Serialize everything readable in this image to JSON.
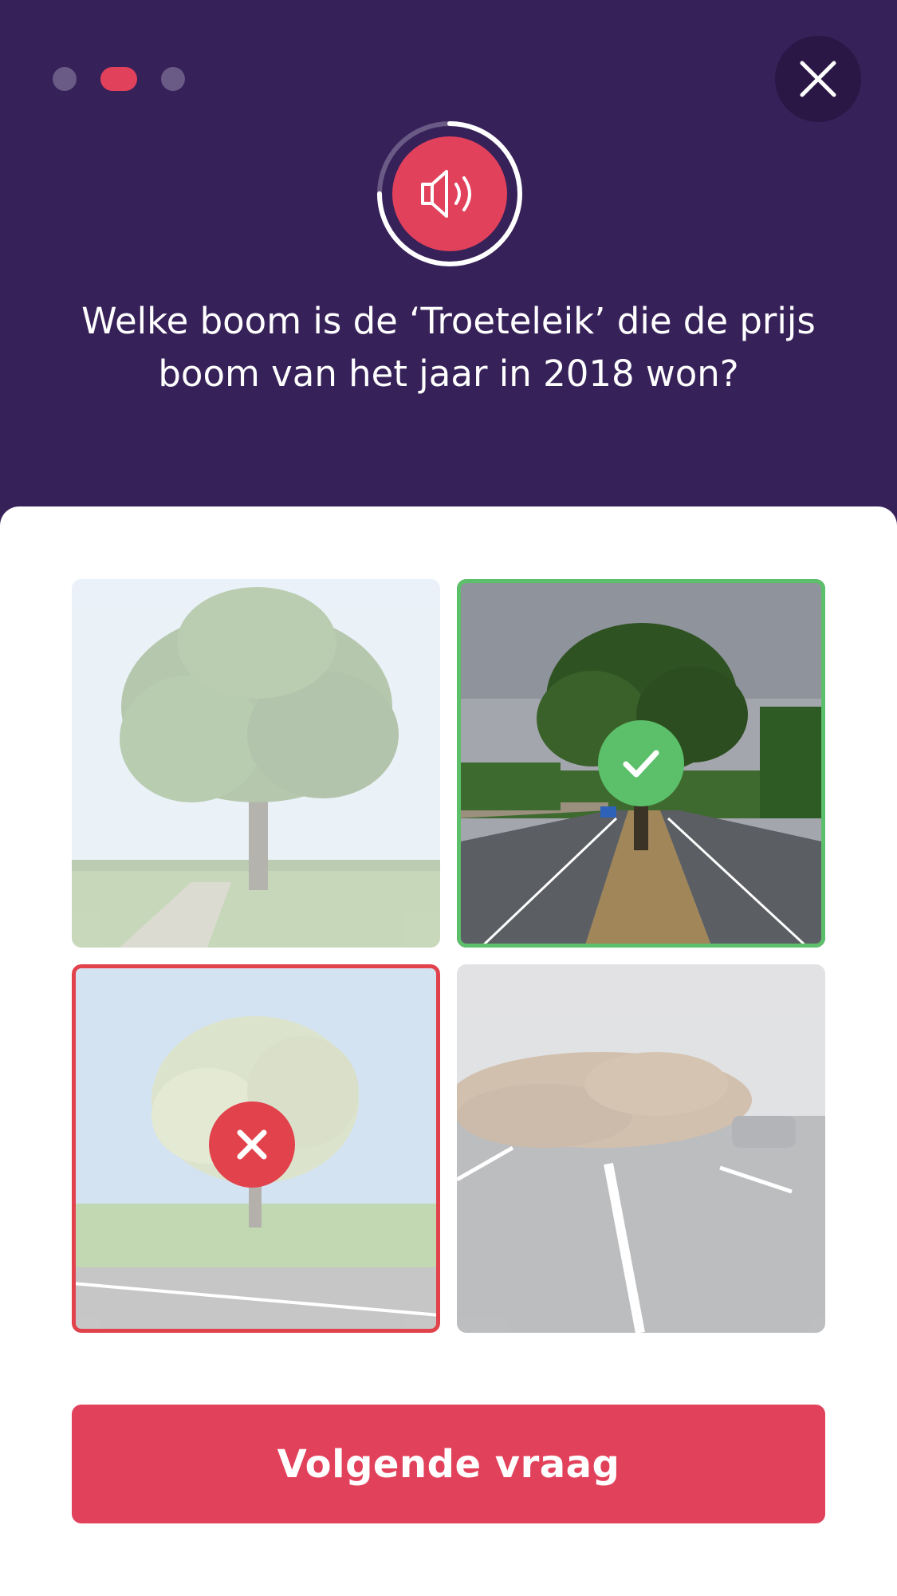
{
  "progress": {
    "total_steps": 3,
    "current_step": 2
  },
  "header": {
    "close_icon": "close-icon",
    "audio_icon": "speaker-icon",
    "audio_timer_fraction": 0.75,
    "question": "Welke boom is de ‘Troeteleik’ die de prijs boom van het jaar in 2018 won?"
  },
  "answers": [
    {
      "status": "neutral",
      "scene": "solitary oak tree in a field"
    },
    {
      "status": "correct",
      "scene": "oak tree in the median of a highway",
      "badge_icon": "checkmark-icon"
    },
    {
      "status": "wrong",
      "scene": "flowering tree beside a country road",
      "badge_icon": "cross-icon"
    },
    {
      "status": "neutral",
      "scene": "fallen tree across a highway"
    }
  ],
  "actions": {
    "next_label": "Volgende vraag"
  },
  "colors": {
    "header_bg": "#372159",
    "accent": "#e2415b",
    "correct": "#5cbf6a",
    "wrong": "#e2424b"
  }
}
